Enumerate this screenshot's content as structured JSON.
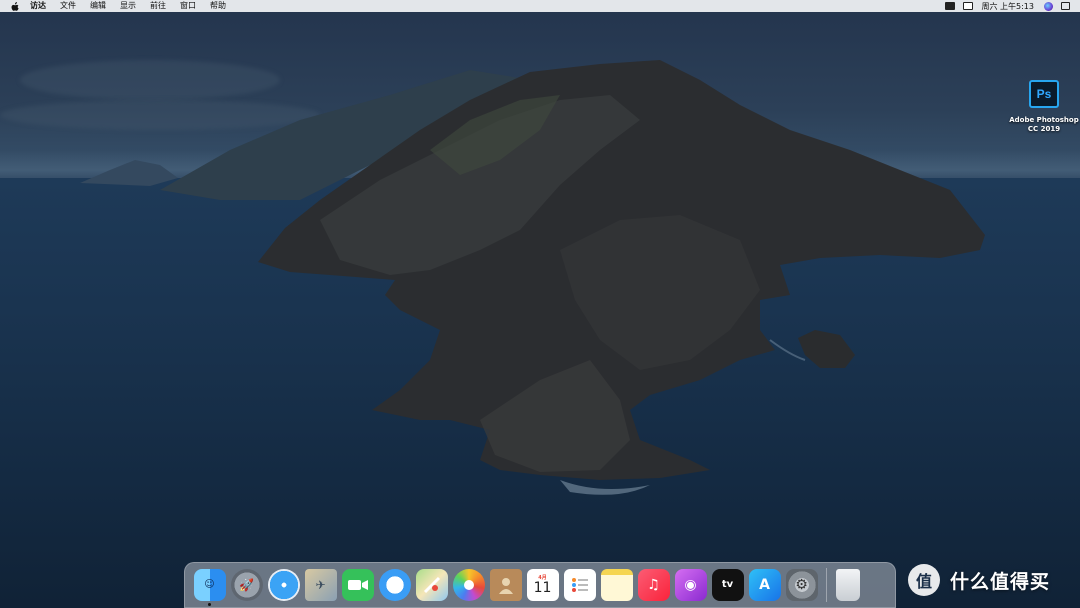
{
  "menubar": {
    "app_name": "访达",
    "menus": [
      "文件",
      "编辑",
      "显示",
      "前往",
      "窗口",
      "帮助"
    ],
    "clock": "周六 上午5:13"
  },
  "desktop_icons": [
    {
      "label": "Adobe Photoshop\nCC 2019",
      "glyph": "Ps"
    }
  ],
  "dock": {
    "apps": [
      {
        "name": "finder",
        "glyph": "",
        "running": true
      },
      {
        "name": "launchpad",
        "glyph": ""
      },
      {
        "name": "safari",
        "glyph": ""
      },
      {
        "name": "mail",
        "glyph": ""
      },
      {
        "name": "facetime",
        "glyph": ""
      },
      {
        "name": "messages",
        "glyph": ""
      },
      {
        "name": "maps",
        "glyph": ""
      },
      {
        "name": "photos",
        "glyph": ""
      },
      {
        "name": "contacts",
        "glyph": ""
      },
      {
        "name": "calendar",
        "month": "4月",
        "day": "11"
      },
      {
        "name": "reminders",
        "glyph": ""
      },
      {
        "name": "notes",
        "glyph": ""
      },
      {
        "name": "music",
        "glyph": "♫"
      },
      {
        "name": "podcasts",
        "glyph": "◉"
      },
      {
        "name": "tv",
        "glyph": "tv"
      },
      {
        "name": "app-store",
        "glyph": "A"
      },
      {
        "name": "system-preferences",
        "glyph": "⚙"
      }
    ],
    "trash": {
      "name": "trash"
    }
  },
  "watermark": {
    "badge": "值",
    "text": "什么值得买"
  },
  "colors": {
    "menubar_bg": "#e3e6ea",
    "sky": "#2c4058",
    "sea": "#1a3450",
    "ps_blue": "#31a8ff"
  }
}
